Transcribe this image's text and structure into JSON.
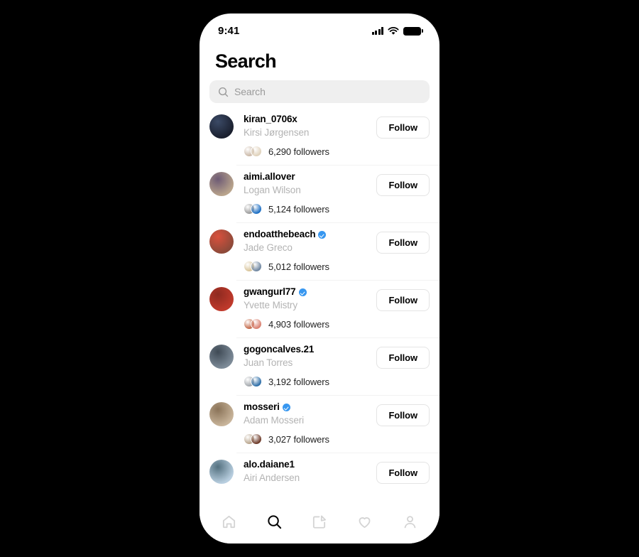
{
  "device": {
    "frame_color": "#000000",
    "screen_color": "#ffffff"
  },
  "status_bar": {
    "time": "9:41",
    "cellular_icon": "cellular-bars-icon",
    "wifi_icon": "wifi-icon",
    "battery_icon": "battery-icon"
  },
  "header": {
    "title": "Search"
  },
  "search": {
    "placeholder": "Search",
    "value": "",
    "icon": "search-icon"
  },
  "accent": {
    "verified_blue": "#3797f0",
    "field_gray": "#efefef",
    "name_gray": "#b3b3b3"
  },
  "follow_label": "Follow",
  "results": [
    {
      "username": "kiran_0706x",
      "full_name": "Kirsi Jørgensen",
      "verified": false,
      "followers": "6,290 followers",
      "avatar": "#1a1f2e",
      "avatar2": "#3b4a66",
      "mini1": "#cbb9a8",
      "mini2": "#e0d2bc",
      "follow_label": "Follow"
    },
    {
      "username": "aimi.allover",
      "full_name": "Logan Wilson",
      "verified": false,
      "followers": "5,124 followers",
      "avatar": "#b9a48c",
      "avatar2": "#6d5a74",
      "mini1": "#9a9a9a",
      "mini2": "#1d6fc4",
      "follow_label": "Follow"
    },
    {
      "username": "endoatthebeach",
      "full_name": "Jade Greco",
      "verified": true,
      "followers": "5,012 followers",
      "avatar": "#8d4a3a",
      "avatar2": "#d9503c",
      "mini1": "#d8c49a",
      "mini2": "#6f86a0",
      "follow_label": "Follow"
    },
    {
      "username": "gwangurl77",
      "full_name": "Yvette Mistry",
      "verified": true,
      "followers": "4,903 followers",
      "avatar": "#c0392b",
      "avatar2": "#8e2a20",
      "mini1": "#c46a4a",
      "mini2": "#d98070",
      "follow_label": "Follow"
    },
    {
      "username": "gogoncalves.21",
      "full_name": "Juan Torres",
      "verified": false,
      "followers": "3,192 followers",
      "avatar": "#7d8b98",
      "avatar2": "#3f4a55",
      "mini1": "#a3a8ad",
      "mini2": "#2f6fa8",
      "follow_label": "Follow"
    },
    {
      "username": "mosseri",
      "full_name": "Adam Mosseri",
      "verified": true,
      "followers": "3,027 followers",
      "avatar": "#c8b49a",
      "avatar2": "#8a7358",
      "mini1": "#b9a68e",
      "mini2": "#6e3b2a",
      "follow_label": "Follow"
    },
    {
      "username": "alo.daiane1",
      "full_name": "Airi Andersen",
      "verified": false,
      "followers": "",
      "avatar": "#b9cfe0",
      "avatar2": "#53707f",
      "mini1": "",
      "mini2": "",
      "follow_label": "Follow"
    }
  ],
  "tabbar": {
    "items": [
      {
        "name": "home-icon",
        "active": false
      },
      {
        "name": "search-icon",
        "active": true
      },
      {
        "name": "compose-icon",
        "active": false
      },
      {
        "name": "heart-icon",
        "active": false
      },
      {
        "name": "profile-icon",
        "active": false
      }
    ]
  }
}
